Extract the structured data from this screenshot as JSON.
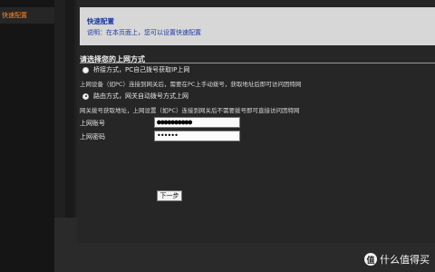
{
  "sidebar": {
    "active_item": "快速配置"
  },
  "header": {
    "title": "快速配置",
    "description": "说明：在本页面上，您可以设置快速配置"
  },
  "section": {
    "title": "请选择您的上网方式"
  },
  "options": [
    {
      "label": "桥接方式，PC自己拨号获取IP上网",
      "selected": false,
      "info": "上网设备（如PC）连接到网关后，需要在PC上手动拨号，获取地址后即可访问因特网"
    },
    {
      "label": "路由方式，网关自动拨号方式上网",
      "selected": true,
      "info": "网关拨号获取地址，上网设置（如PC）连接到网关后不需要拨号即可直接访问因特网"
    }
  ],
  "form": {
    "account_label": "上网账号",
    "account_value": "●●●●●●●●●●",
    "password_label": "上网密码",
    "password_value": "••••••"
  },
  "buttons": {
    "next": "下一步"
  },
  "watermark": {
    "logo": "值",
    "text": "什么值得买"
  }
}
